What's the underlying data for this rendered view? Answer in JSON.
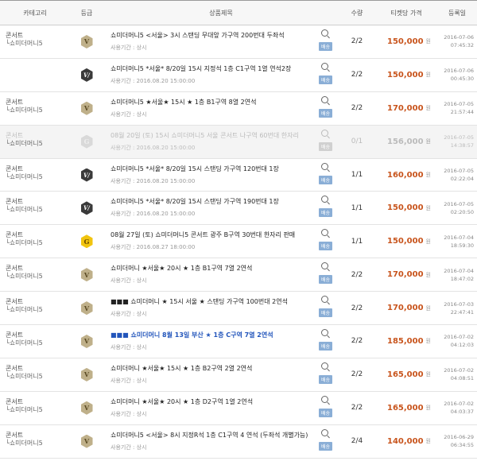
{
  "header": {
    "category": "카테고리",
    "grade": "등급",
    "title": "상품제목",
    "qty": "수량",
    "price": "티켓당 가격",
    "date": "등록일"
  },
  "won": "원",
  "ship": "배송",
  "rows": [
    {
      "cat": "콘서트",
      "sub": "└쇼미더머니5",
      "grade": "V",
      "title": "쇼미더머니5 <서울> 3시 스탠딩 무대앞 가구역 200번대 두좌석",
      "period": "사용기간 : 상시",
      "qty": "2/2",
      "price": "150,000",
      "date": "2016-07-06",
      "time": "07:45:32",
      "disabled": false,
      "hl": false
    },
    {
      "cat": "",
      "sub": "",
      "grade": "VI",
      "title": "쇼미더머니5 *서울* 8/20일 15시 지정석 1층 C1구역 1열 연석2장",
      "period": "사용기간 : 2016.08.20 15:00:00",
      "qty": "2/2",
      "price": "150,000",
      "date": "2016-07-06",
      "time": "00:45:30",
      "disabled": false,
      "hl": false
    },
    {
      "cat": "콘서트",
      "sub": "└쇼미더머니5",
      "grade": "V",
      "title": "쇼미더머니5 ★서울★ 15시 ★ 1층 B1구역 8열 2연석",
      "period": "사용기간 : 상시",
      "qty": "2/2",
      "price": "170,000",
      "date": "2016-07-05",
      "time": "21:57:44",
      "disabled": false,
      "hl": false
    },
    {
      "cat": "콘서트",
      "sub": "└쇼미더머니5",
      "grade": "Gd",
      "title": "08월 20일 (토) 15시 쇼미더머니5 서울 콘서트 나구역 60번대 한자리",
      "period": "사용기간 : 2016.08.20 15:00:00",
      "qty": "0/1",
      "price": "156,000",
      "date": "2016-07-05",
      "time": "14:38:57",
      "disabled": true,
      "hl": false
    },
    {
      "cat": "콘서트",
      "sub": "└쇼미더머니5",
      "grade": "VI",
      "title": "쇼미더머니5 *서울* 8/20일 15시 스탠딩 가구역 120번대 1장",
      "period": "사용기간 : 2016.08.20 15:00:00",
      "qty": "1/1",
      "price": "160,000",
      "date": "2016-07-05",
      "time": "02:22:04",
      "disabled": false,
      "hl": false
    },
    {
      "cat": "콘서트",
      "sub": "└쇼미더머니5",
      "grade": "VI",
      "title": "쇼미더머니5 *서울* 8/20일 15시 스탠딩 가구역 190번대 1장",
      "period": "사용기간 : 2016.08.20 15:00:00",
      "qty": "1/1",
      "price": "150,000",
      "date": "2016-07-05",
      "time": "02:20:50",
      "disabled": false,
      "hl": false
    },
    {
      "cat": "콘서트",
      "sub": "└쇼미더머니5",
      "grade": "G",
      "title": "08월 27일 (토) 쇼미더머니5 콘서트 광주 B구역 30번대 한자리 판매",
      "period": "사용기간 : 2016.08.27 18:00:00",
      "qty": "1/1",
      "price": "150,000",
      "date": "2016-07-04",
      "time": "18:59:30",
      "disabled": false,
      "hl": false
    },
    {
      "cat": "콘서트",
      "sub": "└쇼미더머니5",
      "grade": "V",
      "title": "쇼미더머니 ★서울★ 20시 ★ 1층 B1구역 7열 2연석",
      "period": "사용기간 : 상시",
      "qty": "2/2",
      "price": "170,000",
      "date": "2016-07-04",
      "time": "18:47:02",
      "disabled": false,
      "hl": false
    },
    {
      "cat": "콘서트",
      "sub": "└쇼미더머니5",
      "grade": "V",
      "title": "■■■ 쇼미더머니 ★ 15시 서울 ★ 스탠딩 가구역 100번대 2연석",
      "period": "사용기간 : 상시",
      "qty": "2/2",
      "price": "170,000",
      "date": "2016-07-03",
      "time": "22:47:41",
      "disabled": false,
      "hl": false
    },
    {
      "cat": "콘서트",
      "sub": "└쇼미더머니5",
      "grade": "V",
      "title": "■■■ 쇼미더머니 8월 13일 부산 ★ 1층 C구역 7열 2연석",
      "period": "사용기간 : 상시",
      "qty": "2/2",
      "price": "185,000",
      "date": "2016-07-02",
      "time": "04:12:03",
      "disabled": false,
      "hl": true
    },
    {
      "cat": "콘서트",
      "sub": "└쇼미더머니5",
      "grade": "V",
      "title": "쇼미더머니 ★서울★ 15시 ★ 1층 B2구역 2열 2연석",
      "period": "사용기간 : 상시",
      "qty": "2/2",
      "price": "165,000",
      "date": "2016-07-02",
      "time": "04:08:51",
      "disabled": false,
      "hl": false
    },
    {
      "cat": "콘서트",
      "sub": "└쇼미더머니5",
      "grade": "V",
      "title": "쇼미더머니 ★서울★ 20시 ★ 1층 D2구역 1열 2연석",
      "period": "사용기간 : 상시",
      "qty": "2/2",
      "price": "165,000",
      "date": "2016-07-02",
      "time": "04:03:37",
      "disabled": false,
      "hl": false
    },
    {
      "cat": "콘서트",
      "sub": "└쇼미더머니5",
      "grade": "V",
      "title": "쇼미더머니5 <서울> 8시 지정R석 1층 C1구역 4 연석 (두좌석 개별가능)",
      "period": "사용기간 : 상시",
      "qty": "2/4",
      "price": "140,000",
      "date": "2016-06-29",
      "time": "06:34:55",
      "disabled": false,
      "hl": false
    }
  ]
}
